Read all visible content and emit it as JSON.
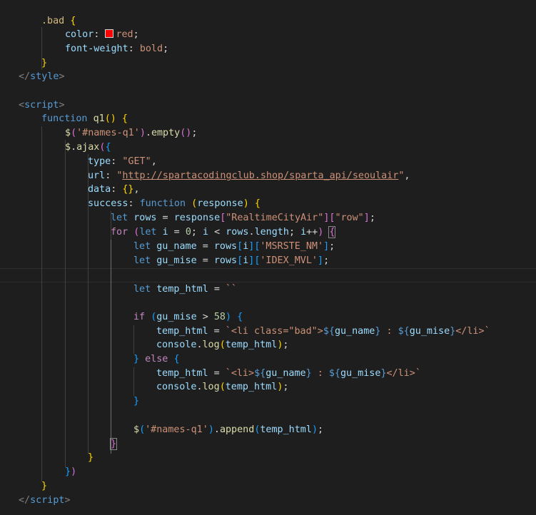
{
  "css": {
    "selector": ".bad",
    "color_prop": "color",
    "color_value": "red",
    "weight_prop": "font-weight",
    "weight_value": "bold",
    "close_tag": "style"
  },
  "js": {
    "open_tag": "script",
    "close_tag": "script",
    "kw_function": "function",
    "fn_name": "q1",
    "selector_str": "'#names-q1'",
    "empty_fn": "empty",
    "ajax_fn": "ajax",
    "type_key": "type",
    "type_val": "\"GET\"",
    "url_key": "url",
    "url_val": "http://spartacodingclub.shop/sparta_api/seoulair",
    "data_key": "data",
    "success_key": "success",
    "param": "response",
    "kw_let": "let",
    "kw_for": "for",
    "kw_if": "if",
    "kw_else": "else",
    "rows_var": "rows",
    "key_realtime": "\"RealtimeCityAir\"",
    "key_row": "\"row\"",
    "i_var": "i",
    "zero": "0",
    "length_prop": "length",
    "gu_name_var": "gu_name",
    "gu_mise_var": "gu_mise",
    "key_msrste": "'MSRSTE_NM'",
    "key_idex": "'IDEX_MVL'",
    "temp_var": "temp_html",
    "empty_template": "``",
    "threshold": "58",
    "bad_li_open": "<li class=\"bad\">",
    "li_open": "<li>",
    "li_close": "</li>",
    "sep": " : ",
    "console_obj": "console",
    "log_fn": "log",
    "append_fn": "append"
  },
  "colors": {
    "background": "#1e1e1e",
    "swatch": "#ff0000"
  }
}
